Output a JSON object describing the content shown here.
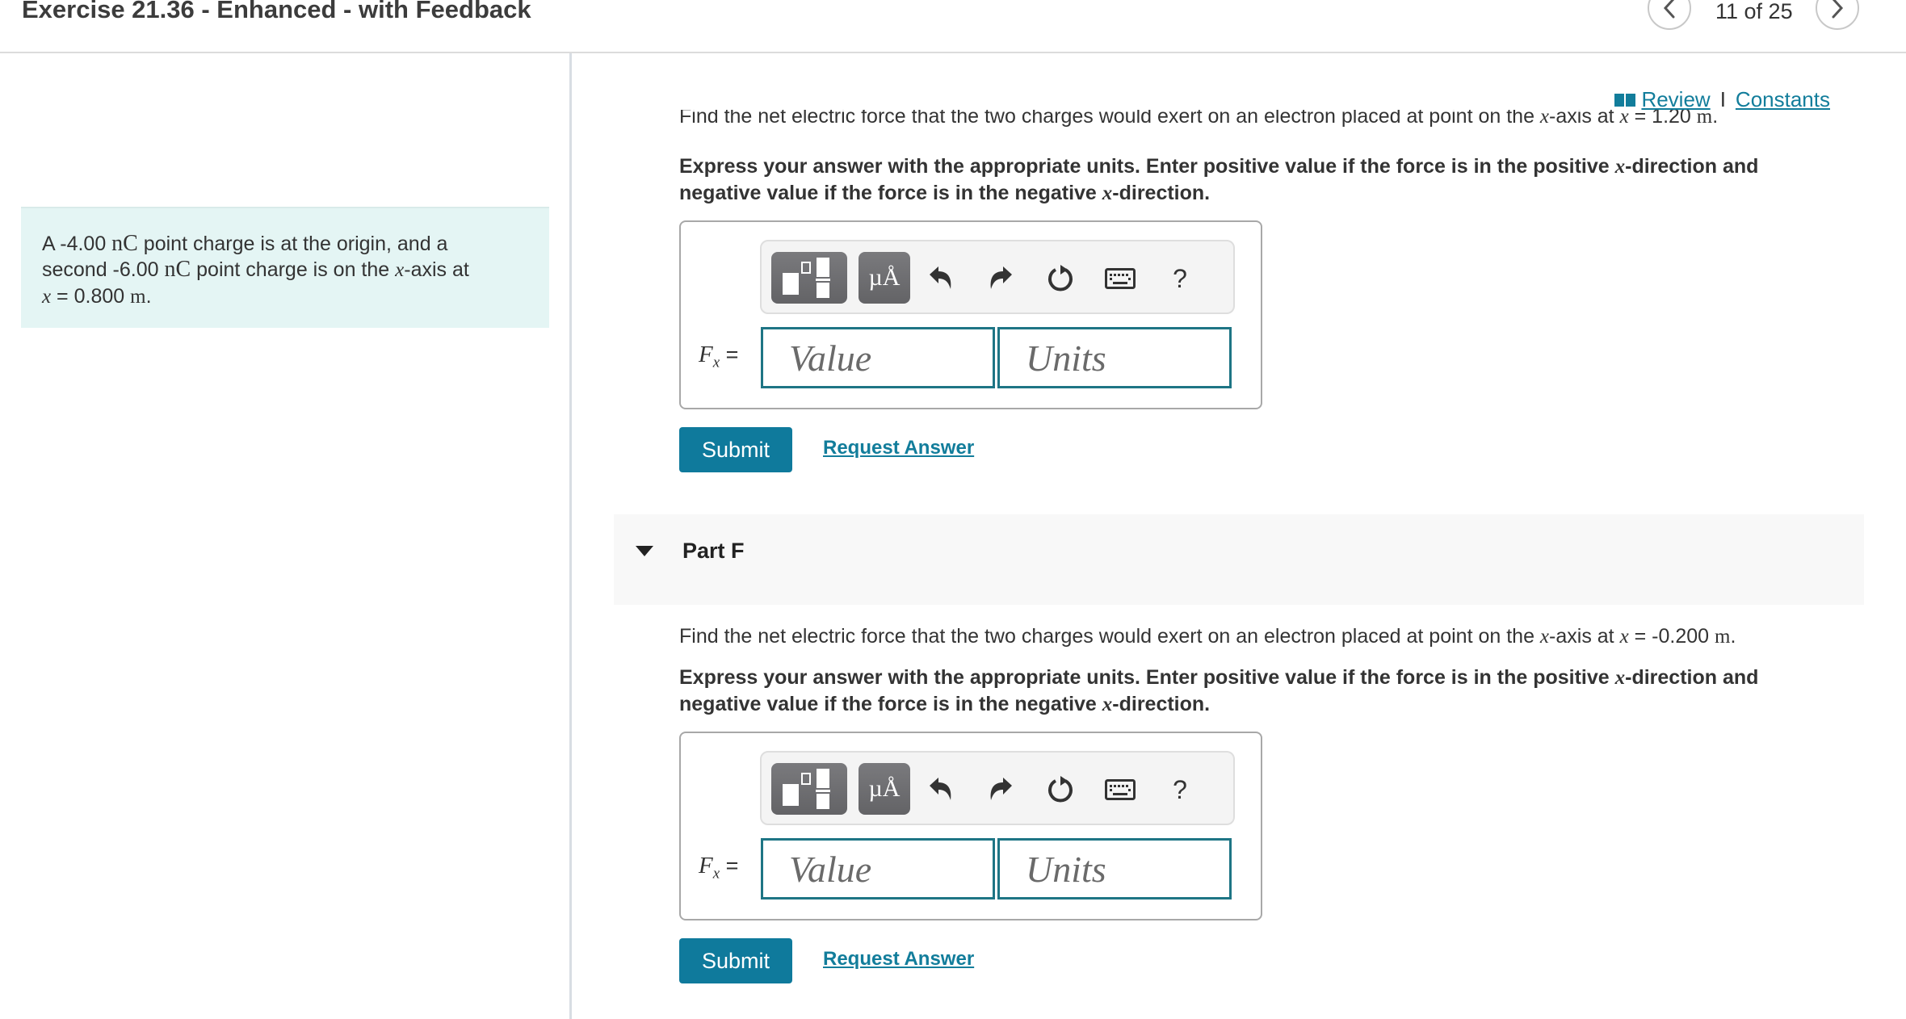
{
  "header": {
    "title": "Exercise 21.36 - Enhanced - with Feedback",
    "pager": {
      "current": 11,
      "total": 25,
      "label": "11 of 25",
      "prev_icon": "chevron-left-icon",
      "next_icon": "chevron-right-icon"
    }
  },
  "context": {
    "line1_a": "A -4.00 ",
    "unit1": "nC",
    "line1_b": " point charge is at the origin, and a",
    "line2_a": "second -6.00 ",
    "unit2": "nC",
    "line2_b": " point charge is on the ",
    "xvar": "x",
    "line2_c": "-axis at",
    "line3_eq": " = 0.800 ",
    "unit3": "m",
    "line3_end": "."
  },
  "links": {
    "review_icon": "book-icon",
    "review": "Review",
    "separator": "I",
    "constants": "Constants"
  },
  "colors": {
    "accent": "#0f7a9c",
    "link": "#127d9b",
    "context_bg": "#e4f5f4",
    "input_border": "#1e7585",
    "part_header_bg": "#f8f8f8"
  },
  "parts": [
    {
      "id": "E",
      "prompt_a": "Find the net electric force that the two charges would exert on an electron placed at point on the ",
      "xvar": "x",
      "prompt_b": "-axis at ",
      "prompt_eq": " = 1.20 ",
      "unit": "m",
      "prompt_end": ".",
      "instr_a": "Express your answer with the appropriate units. Enter positive value if the force is in the positive ",
      "instr_b": "-direction and negative value if the force is in the negative ",
      "instr_c": "-direction.",
      "label_var": "F",
      "label_sub": "x",
      "label_eq": " =",
      "value_placeholder": "Value",
      "value": "",
      "units_placeholder": "Units",
      "units": "",
      "toolbar": {
        "templates": "templates-icon",
        "units_btn": "µÅ",
        "undo": "undo-icon",
        "redo": "redo-icon",
        "reset": "reset-icon",
        "keyboard": "keyboard-icon",
        "help": "?"
      },
      "submit": "Submit",
      "request_answer": "Request Answer"
    },
    {
      "id": "F",
      "header": "Part F",
      "expanded": true,
      "prompt_a": "Find the net electric force that the two charges would exert on an electron placed at point on the ",
      "xvar": "x",
      "prompt_b": "-axis at ",
      "prompt_eq": " = -0.200 ",
      "unit": "m",
      "prompt_end": ".",
      "instr_a": "Express your answer with the appropriate units. Enter positive value if the force is in the positive ",
      "instr_b": "-direction and negative value if the force is in the negative ",
      "instr_c": "-direction.",
      "label_var": "F",
      "label_sub": "x",
      "label_eq": " =",
      "value_placeholder": "Value",
      "value": "",
      "units_placeholder": "Units",
      "units": "",
      "toolbar": {
        "templates": "templates-icon",
        "units_btn": "µÅ",
        "undo": "undo-icon",
        "redo": "redo-icon",
        "reset": "reset-icon",
        "keyboard": "keyboard-icon",
        "help": "?"
      },
      "submit": "Submit",
      "request_answer": "Request Answer"
    }
  ]
}
